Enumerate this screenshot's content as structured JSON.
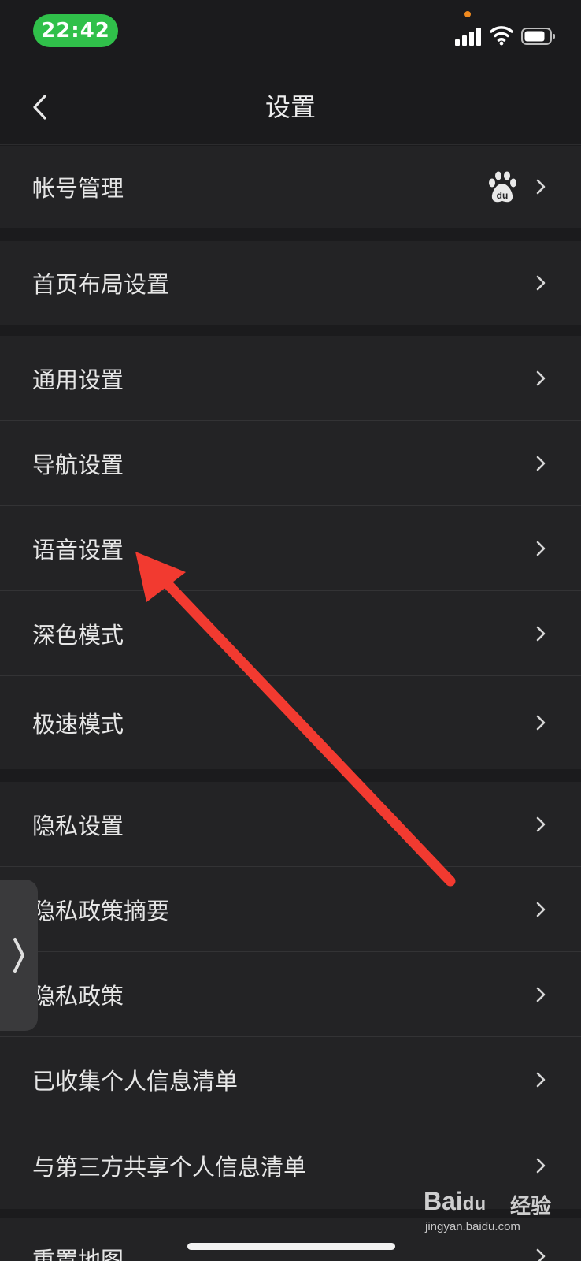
{
  "status_bar": {
    "time": "22:42",
    "dot_color": "#f08a1f",
    "time_pill_color": "#30c04a"
  },
  "header": {
    "back_icon": "chevron-left-icon",
    "title": "设置"
  },
  "groups": [
    {
      "items": [
        {
          "label": "帐号管理",
          "badge_icon": "baidu-paw-icon"
        }
      ]
    },
    {
      "items": [
        {
          "label": "首页布局设置"
        }
      ]
    },
    {
      "items": [
        {
          "label": "通用设置"
        },
        {
          "label": "导航设置"
        },
        {
          "label": "语音设置"
        },
        {
          "label": "深色模式"
        },
        {
          "label": "极速模式"
        }
      ]
    },
    {
      "items": [
        {
          "label": "隐私设置"
        },
        {
          "label": "隐私政策摘要"
        },
        {
          "label": "隐私政策"
        },
        {
          "label": "已收集个人信息清单"
        },
        {
          "label": "与第三方共享个人信息清单"
        }
      ]
    },
    {
      "items": [
        {
          "label": "重置地图"
        }
      ]
    }
  ],
  "annotation": {
    "color": "#f23a30",
    "points_to": "语音设置"
  },
  "watermark": {
    "brand": "Bai",
    "brand_du": "du",
    "brand_cn": "经验",
    "url": "jingyan.baidu.com"
  }
}
